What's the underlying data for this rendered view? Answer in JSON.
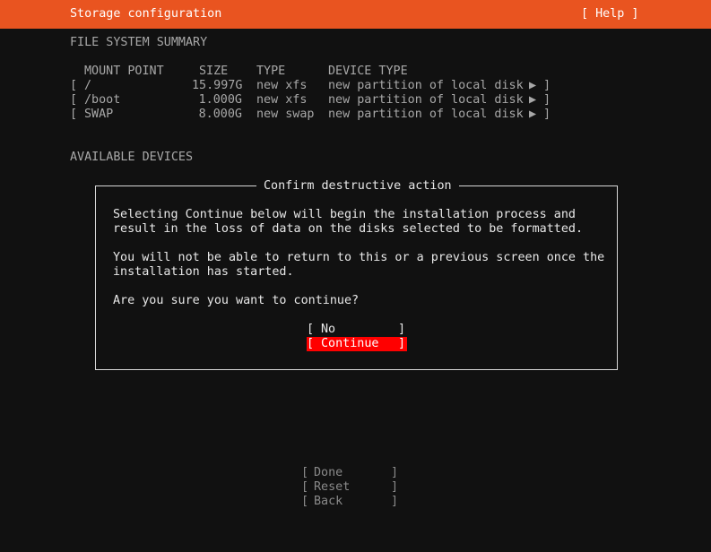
{
  "header": {
    "title": "Storage configuration",
    "help": "[ Help ]"
  },
  "fs_summary": {
    "heading": "FILE SYSTEM SUMMARY",
    "columns": {
      "mount": "MOUNT POINT",
      "size": "SIZE",
      "type": "TYPE",
      "device_type": "DEVICE TYPE"
    },
    "rows": [
      {
        "open": "[",
        "mount": "/",
        "size": "15.997G",
        "type": "new xfs",
        "device_type": "new partition of local disk",
        "arrow": "▶",
        "close": "]"
      },
      {
        "open": "[",
        "mount": "/boot",
        "size": "1.000G",
        "type": "new xfs",
        "device_type": "new partition of local disk",
        "arrow": "▶",
        "close": "]"
      },
      {
        "open": "[",
        "mount": "SWAP",
        "size": "8.000G",
        "type": "new swap",
        "device_type": "new partition of local disk",
        "arrow": "▶",
        "close": "]"
      }
    ]
  },
  "available_devices": {
    "heading": "AVAILABLE DEVICES"
  },
  "dialog": {
    "title": "Confirm destructive action",
    "paragraph1_line1": "Selecting Continue below will begin the installation process and",
    "paragraph1_line2": "result in the loss of data on the disks selected to be formatted.",
    "paragraph2_line1": "You will not be able to return to this or a previous screen once the",
    "paragraph2_line2": "installation has started.",
    "question": "Are you sure you want to continue?",
    "buttons": {
      "open": "[",
      "close": "]",
      "no": "No",
      "continue": "Continue"
    },
    "selected": "continue",
    "selected_color": "#ff0000"
  },
  "bottom_buttons": {
    "open": "[",
    "close": "]",
    "done": "Done",
    "reset": "Reset",
    "back": "Back"
  },
  "colors": {
    "accent": "#e95420",
    "background": "#111111"
  }
}
